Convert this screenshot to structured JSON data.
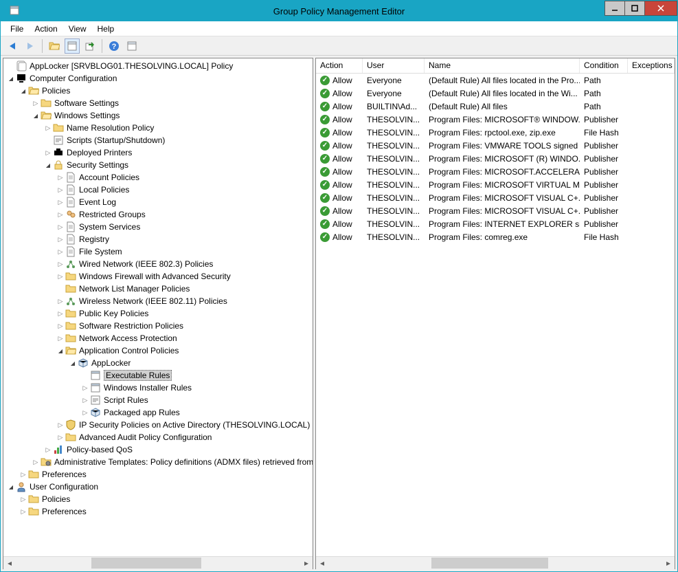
{
  "title": "Group Policy Management Editor",
  "menu": {
    "file": "File",
    "action": "Action",
    "view": "View",
    "help": "Help"
  },
  "tree_root": "AppLocker [SRVBLOG01.THESOLVING.LOCAL] Policy",
  "tree": {
    "computer_config": "Computer Configuration",
    "policies": "Policies",
    "software_settings": "Software Settings",
    "windows_settings": "Windows Settings",
    "name_resolution": "Name Resolution Policy",
    "scripts": "Scripts (Startup/Shutdown)",
    "deployed_printers": "Deployed Printers",
    "security_settings": "Security Settings",
    "account_policies": "Account Policies",
    "local_policies": "Local Policies",
    "event_log": "Event Log",
    "restricted_groups": "Restricted Groups",
    "system_services": "System Services",
    "registry": "Registry",
    "file_system": "File System",
    "wired_network": "Wired Network (IEEE 802.3) Policies",
    "firewall": "Windows Firewall with Advanced Security",
    "network_list": "Network List Manager Policies",
    "wireless_network": "Wireless Network (IEEE 802.11) Policies",
    "public_key": "Public Key Policies",
    "software_restriction": "Software Restriction Policies",
    "network_access": "Network Access Protection",
    "app_control": "Application Control Policies",
    "applocker": "AppLocker",
    "exe_rules": "Executable Rules",
    "installer_rules": "Windows Installer Rules",
    "script_rules": "Script Rules",
    "packaged_rules": "Packaged app Rules",
    "ipsec": "IP Security Policies on Active Directory (THESOLVING.LOCAL)",
    "advanced_audit": "Advanced Audit Policy Configuration",
    "policy_qos": "Policy-based QoS",
    "admin_templates": "Administrative Templates: Policy definitions (ADMX files) retrieved from",
    "preferences": "Preferences",
    "user_config": "User Configuration",
    "user_policies": "Policies",
    "user_preferences": "Preferences"
  },
  "columns": {
    "action": "Action",
    "user": "User",
    "name": "Name",
    "condition": "Condition",
    "exceptions": "Exceptions"
  },
  "rows": [
    {
      "action": "Allow",
      "user": "Everyone",
      "name": "(Default Rule) All files located in the Pro...",
      "cond": "Path"
    },
    {
      "action": "Allow",
      "user": "Everyone",
      "name": "(Default Rule) All files located in the Wi...",
      "cond": "Path"
    },
    {
      "action": "Allow",
      "user": "BUILTIN\\Ad...",
      "name": "(Default Rule) All files",
      "cond": "Path"
    },
    {
      "action": "Allow",
      "user": "THESOLVIN...",
      "name": "Program Files: MICROSOFT® WINDOW...",
      "cond": "Publisher"
    },
    {
      "action": "Allow",
      "user": "THESOLVIN...",
      "name": "Program Files: rpctool.exe, zip.exe",
      "cond": "File Hash"
    },
    {
      "action": "Allow",
      "user": "THESOLVIN...",
      "name": "Program Files: VMWARE TOOLS signed ...",
      "cond": "Publisher"
    },
    {
      "action": "Allow",
      "user": "THESOLVIN...",
      "name": "Program Files: MICROSOFT (R) WINDO...",
      "cond": "Publisher"
    },
    {
      "action": "Allow",
      "user": "THESOLVIN...",
      "name": "Program Files: MICROSOFT.ACCELERA...",
      "cond": "Publisher"
    },
    {
      "action": "Allow",
      "user": "THESOLVIN...",
      "name": "Program Files: MICROSOFT VIRTUAL M...",
      "cond": "Publisher"
    },
    {
      "action": "Allow",
      "user": "THESOLVIN...",
      "name": "Program Files: MICROSOFT VISUAL C+...",
      "cond": "Publisher"
    },
    {
      "action": "Allow",
      "user": "THESOLVIN...",
      "name": "Program Files: MICROSOFT VISUAL C+...",
      "cond": "Publisher"
    },
    {
      "action": "Allow",
      "user": "THESOLVIN...",
      "name": "Program Files: INTERNET EXPLORER sig...",
      "cond": "Publisher"
    },
    {
      "action": "Allow",
      "user": "THESOLVIN...",
      "name": "Program Files: comreg.exe",
      "cond": "File Hash"
    }
  ]
}
